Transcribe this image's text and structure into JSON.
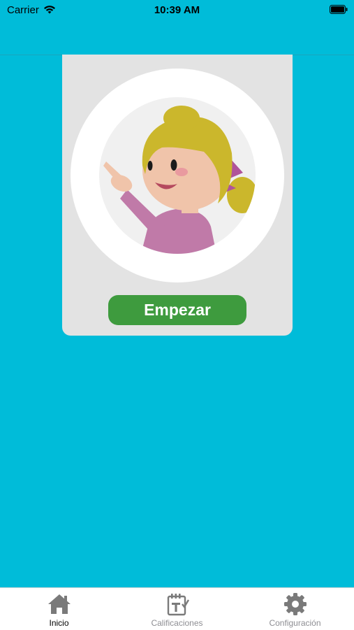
{
  "status_bar": {
    "carrier": "Carrier",
    "time": "10:39 AM"
  },
  "main": {
    "start_button_label": "Empezar"
  },
  "tab_bar": {
    "tabs": [
      {
        "label": "Inicio",
        "icon": "home-icon",
        "active": true
      },
      {
        "label": "Calificaciones",
        "icon": "grades-calendar-icon",
        "active": false
      },
      {
        "label": "Configuración",
        "icon": "gear-icon",
        "active": false
      }
    ]
  },
  "colors": {
    "background": "#00bcd9",
    "card": "#e3e3e3",
    "button": "#3e9b3e",
    "tab_active": "#000000",
    "tab_inactive": "#8e8e93"
  }
}
